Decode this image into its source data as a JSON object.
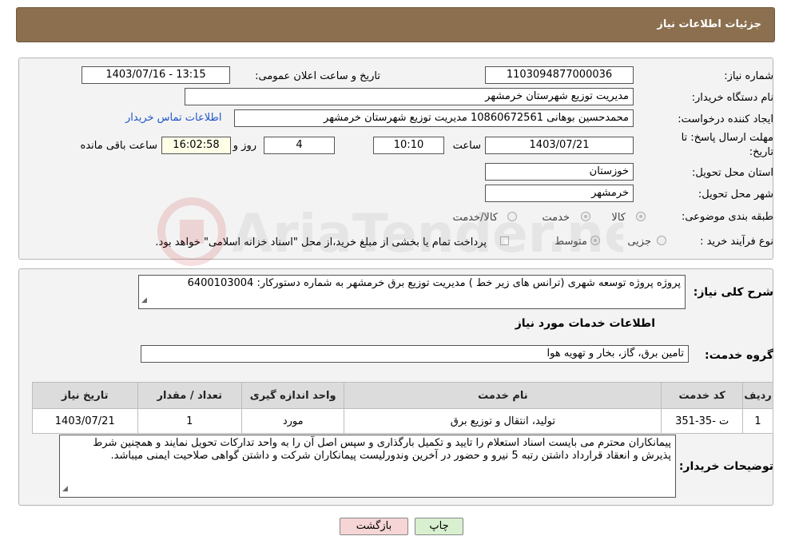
{
  "header": {
    "title": "جزئیات اطلاعات نیاز"
  },
  "need": {
    "number_label": "شماره نیاز:",
    "number_value": "1103094877000036",
    "announce_label": "تاریخ و ساعت اعلان عمومی:",
    "announce_value": "1403/07/16 - 13:15",
    "buyer_label": "نام دستگاه خریدار:",
    "buyer_value": "مدیریت توزیع شهرستان خرمشهر",
    "creator_label": "ایجاد کننده درخواست:",
    "creator_value": "محمدحسین بوهانی 10860672561 مدیریت توزیع شهرستان خرمشهر",
    "contact_link": "اطلاعات تماس خریدار",
    "deadline_label_line1": "مهلت ارسال پاسخ: تا",
    "deadline_label_line2": "تاریخ:",
    "deadline_date": "1403/07/21",
    "time_label": "ساعت",
    "deadline_time": "10:10",
    "days_value": "4",
    "days_label": "روز و",
    "remaining_time": "16:02:58",
    "remaining_label": "ساعت باقی مانده",
    "province_label": "استان محل تحویل:",
    "province_value": "خوزستان",
    "city_label": "شهر محل تحویل:",
    "city_value": "خرمشهر",
    "category_label": "طبقه بندی موضوعی:",
    "category_options": [
      "کالا",
      "خدمت",
      "کالا/خدمت"
    ],
    "purchase_type_label": "نوع فرآیند خرید :",
    "purchase_options": [
      "جزیی",
      "متوسط"
    ],
    "payment_note": "پرداخت تمام یا بخشی از مبلغ خرید،از محل \"اسناد خزانه اسلامی\" خواهد بود."
  },
  "description": {
    "label": "شرح کلی نیاز:",
    "value": "پروژه پروژه توسعه شهری (ترانس های زیر خط )  مدیریت توزیع برق خرمشهر به شماره دستورکار: 6400103004"
  },
  "services": {
    "section_title": "اطلاعات خدمات مورد نیاز",
    "group_label": "گروه خدمت:",
    "group_value": "تامین برق، گاز، بخار و تهویه هوا",
    "columns": [
      "ردیف",
      "کد خدمت",
      "نام خدمت",
      "واحد اندازه گیری",
      "تعداد / مقدار",
      "تاریخ نیاز"
    ],
    "rows": [
      [
        "1",
        "ت -35-351",
        "تولید، انتقال و توزیع برق",
        "مورد",
        "1",
        "1403/07/21"
      ]
    ]
  },
  "buyer_notes": {
    "label": "توضیحات خریدار:",
    "value": "پیمانکاران محترم می بایست اسناد استعلام را تایید و تکمیل بارگذاری و سپس اصل آن را به واحد تدارکات تحویل نمایند و همچنین شرط پذیرش و انعقاد قرارداد داشتن رتبه 5 نیرو و حضور در آخرین وندورلیست پیمانکاران شرکت و داشتن گواهی صلاحیت ایمنی میباشد."
  },
  "buttons": {
    "print": "چاپ",
    "back": "بازگشت"
  },
  "watermark": "AriaTender.neT",
  "colors": {
    "header_bg": "#8b6f4e",
    "link": "#1f55c9",
    "back_btn_bg": "#f5d5d5",
    "print_btn_bg": "#d8f0d0"
  }
}
